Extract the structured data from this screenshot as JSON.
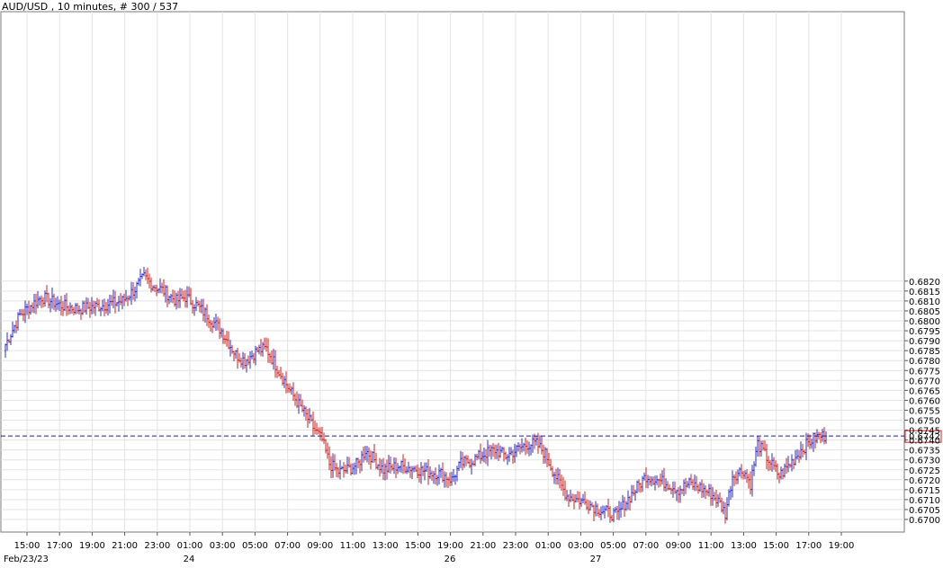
{
  "header": {
    "title": "AUD/USD , 10 minutes, # 300 / 537"
  },
  "chart_data": {
    "type": "ohlc",
    "symbol": "AUD/USD",
    "timeframe": "10 minutes",
    "ylim": [
      0.6696,
      0.6828
    ],
    "y_ticks": [
      "0.6700",
      "0.6705",
      "0.6710",
      "0.6715",
      "0.6720",
      "0.6725",
      "0.6730",
      "0.6735",
      "0.6740",
      "0.6745",
      "0.6750",
      "0.6755",
      "0.6760",
      "0.6765",
      "0.6770",
      "0.6775",
      "0.6780",
      "0.6785",
      "0.6790",
      "0.6795",
      "0.6800",
      "0.6805",
      "0.6810",
      "0.6815",
      "0.6820"
    ],
    "x_ticks": [
      "15:00",
      "17:00",
      "19:00",
      "21:00",
      "23:00",
      "01:00",
      "03:00",
      "05:00",
      "07:00",
      "09:00",
      "11:00",
      "13:00",
      "15:00",
      "19:00",
      "21:00",
      "23:00",
      "01:00",
      "03:00",
      "05:00",
      "07:00",
      "09:00",
      "11:00",
      "13:00",
      "15:00",
      "17:00",
      "19:00"
    ],
    "date_labels": [
      "Feb/23/23",
      "24",
      "26",
      "27"
    ],
    "current_price": "0.6742",
    "current_price_value": 0.6742,
    "grid": true,
    "up_color": "#2b2bc8",
    "down_color": "#cc1f1f",
    "anchors": [
      [
        0,
        0.6788
      ],
      [
        8,
        0.6803
      ],
      [
        20,
        0.6812
      ],
      [
        30,
        0.6808
      ],
      [
        40,
        0.6806
      ],
      [
        55,
        0.6808
      ],
      [
        65,
        0.681
      ],
      [
        72,
        0.6816
      ],
      [
        77,
        0.6822
      ],
      [
        82,
        0.6818
      ],
      [
        88,
        0.6815
      ],
      [
        95,
        0.681
      ],
      [
        100,
        0.6812
      ],
      [
        106,
        0.6808
      ],
      [
        112,
        0.6803
      ],
      [
        120,
        0.6795
      ],
      [
        128,
        0.6783
      ],
      [
        133,
        0.678
      ],
      [
        140,
        0.6785
      ],
      [
        145,
        0.6786
      ],
      [
        150,
        0.6778
      ],
      [
        158,
        0.6765
      ],
      [
        165,
        0.6755
      ],
      [
        172,
        0.6745
      ],
      [
        176,
        0.674
      ],
      [
        180,
        0.6728
      ],
      [
        185,
        0.6724
      ],
      [
        190,
        0.6725
      ],
      [
        196,
        0.6728
      ],
      [
        200,
        0.6735
      ],
      [
        205,
        0.673
      ],
      [
        210,
        0.6725
      ],
      [
        218,
        0.6727
      ],
      [
        226,
        0.6726
      ],
      [
        234,
        0.6724
      ],
      [
        242,
        0.6723
      ],
      [
        248,
        0.672
      ],
      [
        253,
        0.6728
      ],
      [
        260,
        0.673
      ],
      [
        266,
        0.6733
      ],
      [
        272,
        0.6735
      ],
      [
        278,
        0.6732
      ],
      [
        284,
        0.6735
      ],
      [
        290,
        0.6738
      ],
      [
        295,
        0.6738
      ],
      [
        300,
        0.6733
      ],
      [
        304,
        0.6725
      ],
      [
        308,
        0.6718
      ],
      [
        312,
        0.6712
      ],
      [
        318,
        0.671
      ],
      [
        324,
        0.6708
      ],
      [
        330,
        0.6705
      ],
      [
        336,
        0.6703
      ],
      [
        340,
        0.6702
      ],
      [
        344,
        0.6708
      ],
      [
        350,
        0.6715
      ],
      [
        356,
        0.6722
      ],
      [
        362,
        0.672
      ],
      [
        368,
        0.6718
      ],
      [
        374,
        0.6715
      ],
      [
        380,
        0.6718
      ],
      [
        386,
        0.6716
      ],
      [
        392,
        0.6713
      ],
      [
        397,
        0.6708
      ],
      [
        400,
        0.6703
      ],
      [
        404,
        0.6722
      ],
      [
        410,
        0.6725
      ],
      [
        414,
        0.6718
      ],
      [
        418,
        0.6738
      ],
      [
        424,
        0.673
      ],
      [
        430,
        0.6722
      ],
      [
        436,
        0.6728
      ],
      [
        442,
        0.6735
      ],
      [
        448,
        0.674
      ],
      [
        452,
        0.6742
      ],
      [
        456,
        0.6742
      ]
    ]
  }
}
